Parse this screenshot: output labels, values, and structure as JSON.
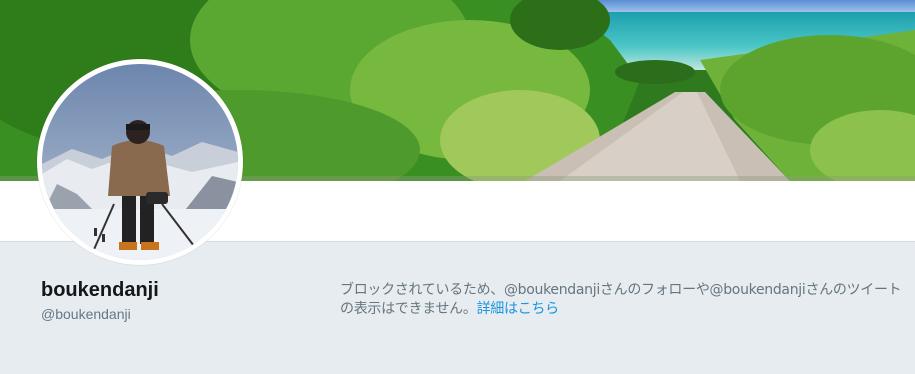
{
  "profile": {
    "display_name": "boukendanji",
    "handle": "@boukendanji"
  },
  "blocked_notice": {
    "message": "ブロックされているため、@boukendanjiさんのフォローや@boukendanjiさんのツイートの表示はできません。",
    "learn_more_link": "詳細はこちら"
  },
  "colors": {
    "link": "#1b95e0",
    "page_background": "#e6ecf0",
    "name_text": "#14171a",
    "secondary_text": "#657786"
  }
}
